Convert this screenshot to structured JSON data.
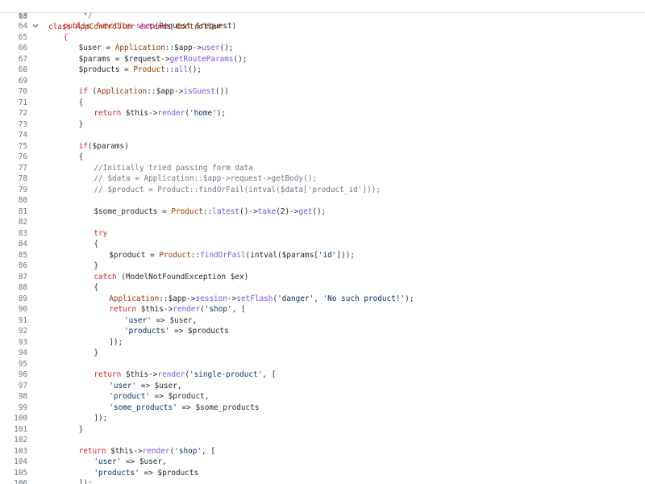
{
  "editor": {
    "sticky_line": {
      "number": "18",
      "tokens": [
        {
          "t": "class ",
          "c": "kw"
        },
        {
          "t": "AppController ",
          "c": "cls"
        },
        {
          "t": "extends ",
          "c": "kw"
        },
        {
          "t": "Controller",
          "c": "cls"
        }
      ]
    },
    "lines": [
      {
        "n": "63",
        "indent": 4,
        "tokens": [
          {
            "t": " */",
            "c": "cm"
          }
        ]
      },
      {
        "n": "64",
        "indent": 2,
        "fold": true,
        "tokens": [
          {
            "t": "public ",
            "c": "kw"
          },
          {
            "t": "function ",
            "c": "kw"
          },
          {
            "t": "shop",
            "c": "fn"
          },
          {
            "t": "(Request ",
            "c": "plain"
          },
          {
            "t": "$request",
            "c": "var"
          },
          {
            "t": ")",
            "c": "plain"
          }
        ]
      },
      {
        "n": "65",
        "indent": 2,
        "tokens": [
          {
            "t": "{",
            "c": "kw"
          }
        ]
      },
      {
        "n": "66",
        "indent": 4,
        "tokens": [
          {
            "t": "$user",
            "c": "var"
          },
          {
            "t": " = ",
            "c": "op"
          },
          {
            "t": "Application",
            "c": "cls"
          },
          {
            "t": "::",
            "c": "op"
          },
          {
            "t": "$app",
            "c": "var"
          },
          {
            "t": "->",
            "c": "op"
          },
          {
            "t": "user",
            "c": "fn"
          },
          {
            "t": "();",
            "c": "plain"
          }
        ]
      },
      {
        "n": "67",
        "indent": 4,
        "tokens": [
          {
            "t": "$params",
            "c": "var"
          },
          {
            "t": " = ",
            "c": "op"
          },
          {
            "t": "$request",
            "c": "var"
          },
          {
            "t": "->",
            "c": "op"
          },
          {
            "t": "getRouteParams",
            "c": "fn"
          },
          {
            "t": "();",
            "c": "plain"
          }
        ]
      },
      {
        "n": "68",
        "indent": 4,
        "tokens": [
          {
            "t": "$products",
            "c": "var"
          },
          {
            "t": " = ",
            "c": "op"
          },
          {
            "t": "Product",
            "c": "cls"
          },
          {
            "t": "::",
            "c": "op"
          },
          {
            "t": "all",
            "c": "fn"
          },
          {
            "t": "();",
            "c": "plain"
          }
        ]
      },
      {
        "n": "69",
        "indent": 0,
        "tokens": []
      },
      {
        "n": "70",
        "indent": 4,
        "tokens": [
          {
            "t": "if ",
            "c": "kw"
          },
          {
            "t": "(",
            "c": "plain"
          },
          {
            "t": "Application",
            "c": "cls"
          },
          {
            "t": "::",
            "c": "op"
          },
          {
            "t": "$app",
            "c": "var"
          },
          {
            "t": "->",
            "c": "op"
          },
          {
            "t": "isGuest",
            "c": "fn"
          },
          {
            "t": "())",
            "c": "plain"
          }
        ]
      },
      {
        "n": "71",
        "indent": 4,
        "tokens": [
          {
            "t": "{",
            "c": "plain"
          }
        ]
      },
      {
        "n": "72",
        "indent": 6,
        "tokens": [
          {
            "t": "return ",
            "c": "kw"
          },
          {
            "t": "$this",
            "c": "var"
          },
          {
            "t": "->",
            "c": "op"
          },
          {
            "t": "render",
            "c": "fn"
          },
          {
            "t": "(",
            "c": "plain"
          },
          {
            "t": "'home'",
            "c": "str"
          },
          {
            "t": ");",
            "c": "plain"
          }
        ]
      },
      {
        "n": "73",
        "indent": 4,
        "tokens": [
          {
            "t": "}",
            "c": "plain"
          }
        ]
      },
      {
        "n": "74",
        "indent": 0,
        "tokens": []
      },
      {
        "n": "75",
        "indent": 4,
        "tokens": [
          {
            "t": "if",
            "c": "kw"
          },
          {
            "t": "(",
            "c": "plain"
          },
          {
            "t": "$params",
            "c": "var"
          },
          {
            "t": ")",
            "c": "plain"
          }
        ]
      },
      {
        "n": "76",
        "indent": 4,
        "tokens": [
          {
            "t": "{",
            "c": "plain"
          }
        ]
      },
      {
        "n": "77",
        "indent": 6,
        "tokens": [
          {
            "t": "//Initially tried passing form data",
            "c": "cm"
          }
        ]
      },
      {
        "n": "78",
        "indent": 6,
        "tokens": [
          {
            "t": "// $data = Application::$app->request->getBody();",
            "c": "cm"
          }
        ]
      },
      {
        "n": "79",
        "indent": 6,
        "tokens": [
          {
            "t": "// $product = Product::findOrFail(intval($data['product_id']));",
            "c": "cm"
          }
        ]
      },
      {
        "n": "80",
        "indent": 0,
        "tokens": []
      },
      {
        "n": "81",
        "indent": 6,
        "tokens": [
          {
            "t": "$some_products",
            "c": "var"
          },
          {
            "t": " = ",
            "c": "op"
          },
          {
            "t": "Product",
            "c": "cls"
          },
          {
            "t": "::",
            "c": "op"
          },
          {
            "t": "latest",
            "c": "fn"
          },
          {
            "t": "()->",
            "c": "plain"
          },
          {
            "t": "take",
            "c": "fn"
          },
          {
            "t": "(2)->",
            "c": "plain"
          },
          {
            "t": "get",
            "c": "fn"
          },
          {
            "t": "();",
            "c": "plain"
          }
        ]
      },
      {
        "n": "82",
        "indent": 0,
        "tokens": []
      },
      {
        "n": "83",
        "indent": 6,
        "tokens": [
          {
            "t": "try",
            "c": "kw"
          }
        ]
      },
      {
        "n": "84",
        "indent": 6,
        "tokens": [
          {
            "t": "{",
            "c": "plain"
          }
        ]
      },
      {
        "n": "85",
        "indent": 8,
        "tokens": [
          {
            "t": "$product",
            "c": "var"
          },
          {
            "t": " = ",
            "c": "op"
          },
          {
            "t": "Product",
            "c": "cls"
          },
          {
            "t": "::",
            "c": "op"
          },
          {
            "t": "findOrFail",
            "c": "fn"
          },
          {
            "t": "(intval(",
            "c": "plain"
          },
          {
            "t": "$params",
            "c": "var"
          },
          {
            "t": "[",
            "c": "plain"
          },
          {
            "t": "'id'",
            "c": "str"
          },
          {
            "t": "]));",
            "c": "plain"
          }
        ]
      },
      {
        "n": "86",
        "indent": 6,
        "tokens": [
          {
            "t": "}",
            "c": "plain"
          }
        ]
      },
      {
        "n": "87",
        "indent": 6,
        "tokens": [
          {
            "t": "catch ",
            "c": "kw"
          },
          {
            "t": "(ModelNotFoundException ",
            "c": "plain"
          },
          {
            "t": "$ex",
            "c": "var"
          },
          {
            "t": ")",
            "c": "plain"
          }
        ]
      },
      {
        "n": "88",
        "indent": 6,
        "tokens": [
          {
            "t": "{",
            "c": "plain"
          }
        ]
      },
      {
        "n": "89",
        "indent": 8,
        "tokens": [
          {
            "t": "Application",
            "c": "cls"
          },
          {
            "t": "::",
            "c": "op"
          },
          {
            "t": "$app",
            "c": "var"
          },
          {
            "t": "->",
            "c": "op"
          },
          {
            "t": "session",
            "c": "fn"
          },
          {
            "t": "->",
            "c": "op"
          },
          {
            "t": "setFlash",
            "c": "fn"
          },
          {
            "t": "(",
            "c": "plain"
          },
          {
            "t": "'danger'",
            "c": "str"
          },
          {
            "t": ", ",
            "c": "plain"
          },
          {
            "t": "'No such product!'",
            "c": "str"
          },
          {
            "t": ");",
            "c": "plain"
          }
        ]
      },
      {
        "n": "90",
        "indent": 8,
        "tokens": [
          {
            "t": "return ",
            "c": "kw"
          },
          {
            "t": "$this",
            "c": "var"
          },
          {
            "t": "->",
            "c": "op"
          },
          {
            "t": "render",
            "c": "fn"
          },
          {
            "t": "(",
            "c": "plain"
          },
          {
            "t": "'shop'",
            "c": "str"
          },
          {
            "t": ", [",
            "c": "plain"
          }
        ]
      },
      {
        "n": "91",
        "indent": 10,
        "tokens": [
          {
            "t": "'user'",
            "c": "str"
          },
          {
            "t": " => ",
            "c": "op"
          },
          {
            "t": "$user",
            "c": "var"
          },
          {
            "t": ",",
            "c": "plain"
          }
        ]
      },
      {
        "n": "92",
        "indent": 10,
        "tokens": [
          {
            "t": "'products'",
            "c": "str"
          },
          {
            "t": " => ",
            "c": "op"
          },
          {
            "t": "$products",
            "c": "var"
          }
        ]
      },
      {
        "n": "93",
        "indent": 8,
        "tokens": [
          {
            "t": "]);",
            "c": "plain"
          }
        ]
      },
      {
        "n": "94",
        "indent": 6,
        "tokens": [
          {
            "t": "}",
            "c": "plain"
          }
        ]
      },
      {
        "n": "95",
        "indent": 0,
        "tokens": []
      },
      {
        "n": "96",
        "indent": 6,
        "tokens": [
          {
            "t": "return ",
            "c": "kw"
          },
          {
            "t": "$this",
            "c": "var"
          },
          {
            "t": "->",
            "c": "op"
          },
          {
            "t": "render",
            "c": "fn"
          },
          {
            "t": "(",
            "c": "plain"
          },
          {
            "t": "'single-product'",
            "c": "str"
          },
          {
            "t": ", [",
            "c": "plain"
          }
        ]
      },
      {
        "n": "97",
        "indent": 8,
        "tokens": [
          {
            "t": "'user'",
            "c": "str"
          },
          {
            "t": " => ",
            "c": "op"
          },
          {
            "t": "$user",
            "c": "var"
          },
          {
            "t": ",",
            "c": "plain"
          }
        ]
      },
      {
        "n": "98",
        "indent": 8,
        "tokens": [
          {
            "t": "'product'",
            "c": "str"
          },
          {
            "t": " => ",
            "c": "op"
          },
          {
            "t": "$product",
            "c": "var"
          },
          {
            "t": ",",
            "c": "plain"
          }
        ]
      },
      {
        "n": "99",
        "indent": 8,
        "tokens": [
          {
            "t": "'some_products'",
            "c": "str"
          },
          {
            "t": " => ",
            "c": "op"
          },
          {
            "t": "$some_products",
            "c": "var"
          }
        ]
      },
      {
        "n": "100",
        "indent": 6,
        "tokens": [
          {
            "t": "]);",
            "c": "plain"
          }
        ]
      },
      {
        "n": "101",
        "indent": 4,
        "tokens": [
          {
            "t": "}",
            "c": "plain"
          }
        ]
      },
      {
        "n": "102",
        "indent": 0,
        "tokens": []
      },
      {
        "n": "103",
        "indent": 4,
        "tokens": [
          {
            "t": "return ",
            "c": "kw"
          },
          {
            "t": "$this",
            "c": "var"
          },
          {
            "t": "->",
            "c": "op"
          },
          {
            "t": "render",
            "c": "fn"
          },
          {
            "t": "(",
            "c": "plain"
          },
          {
            "t": "'shop'",
            "c": "str"
          },
          {
            "t": ", [",
            "c": "plain"
          }
        ]
      },
      {
        "n": "104",
        "indent": 6,
        "tokens": [
          {
            "t": "'user'",
            "c": "str"
          },
          {
            "t": " => ",
            "c": "op"
          },
          {
            "t": "$user",
            "c": "var"
          },
          {
            "t": ",",
            "c": "plain"
          }
        ]
      },
      {
        "n": "105",
        "indent": 6,
        "tokens": [
          {
            "t": "'products'",
            "c": "str"
          },
          {
            "t": " => ",
            "c": "op"
          },
          {
            "t": "$products",
            "c": "var"
          }
        ]
      },
      {
        "n": "106",
        "indent": 4,
        "tokens": [
          {
            "t": "]);",
            "c": "plain"
          }
        ]
      }
    ],
    "fold_icon": "chevron-down-icon"
  }
}
